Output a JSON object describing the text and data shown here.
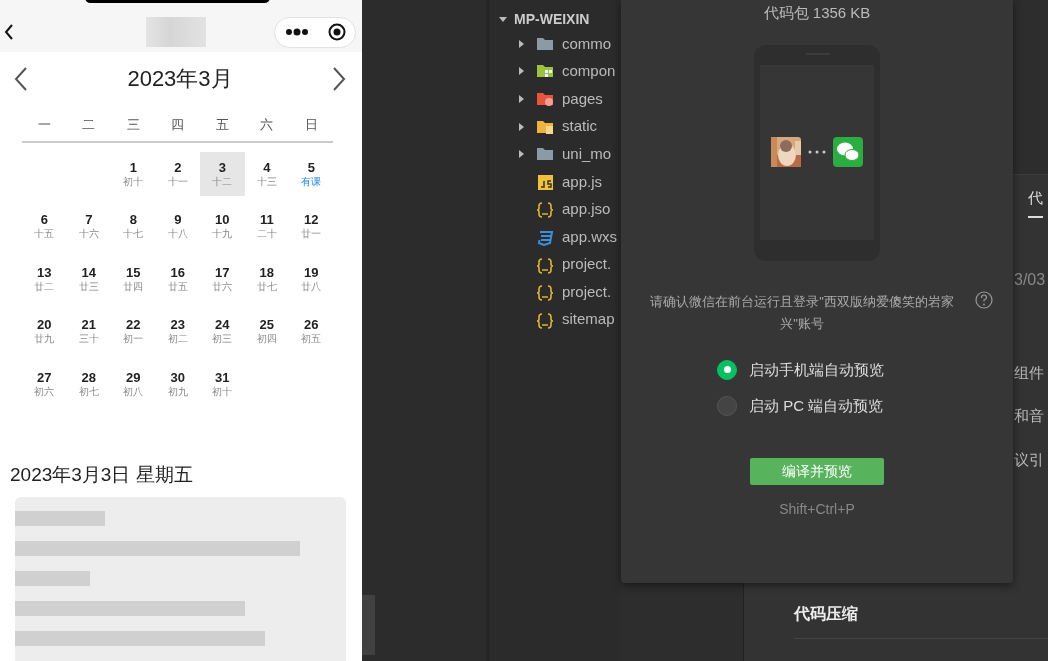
{
  "simulator": {
    "calendar": {
      "title": "2023年3月",
      "weekdays": [
        "一",
        "二",
        "三",
        "四",
        "五",
        "六",
        "日"
      ],
      "weeks": [
        [
          {
            "kind": "blank"
          },
          {
            "kind": "blank"
          },
          {
            "kind": "day",
            "day": "1",
            "lunar": "初十",
            "selected": false,
            "marked": false
          },
          {
            "kind": "day",
            "day": "2",
            "lunar": "十一",
            "selected": false,
            "marked": false
          },
          {
            "kind": "day",
            "day": "3",
            "lunar": "十二",
            "selected": true,
            "marked": false
          },
          {
            "kind": "day",
            "day": "4",
            "lunar": "十三",
            "selected": false,
            "marked": false
          },
          {
            "kind": "day",
            "day": "5",
            "lunar": "有课",
            "selected": false,
            "marked": true
          }
        ],
        [
          {
            "kind": "day",
            "day": "6",
            "lunar": "十五",
            "selected": false,
            "marked": false
          },
          {
            "kind": "day",
            "day": "7",
            "lunar": "十六",
            "selected": false,
            "marked": false
          },
          {
            "kind": "day",
            "day": "8",
            "lunar": "十七",
            "selected": false,
            "marked": false
          },
          {
            "kind": "day",
            "day": "9",
            "lunar": "十八",
            "selected": false,
            "marked": false
          },
          {
            "kind": "day",
            "day": "10",
            "lunar": "十九",
            "selected": false,
            "marked": false
          },
          {
            "kind": "day",
            "day": "11",
            "lunar": "二十",
            "selected": false,
            "marked": false
          },
          {
            "kind": "day",
            "day": "12",
            "lunar": "廿一",
            "selected": false,
            "marked": false
          }
        ],
        [
          {
            "kind": "day",
            "day": "13",
            "lunar": "廿二",
            "selected": false,
            "marked": false
          },
          {
            "kind": "day",
            "day": "14",
            "lunar": "廿三",
            "selected": false,
            "marked": false
          },
          {
            "kind": "day",
            "day": "15",
            "lunar": "廿四",
            "selected": false,
            "marked": false
          },
          {
            "kind": "day",
            "day": "16",
            "lunar": "廿五",
            "selected": false,
            "marked": false
          },
          {
            "kind": "day",
            "day": "17",
            "lunar": "廿六",
            "selected": false,
            "marked": false
          },
          {
            "kind": "day",
            "day": "18",
            "lunar": "廿七",
            "selected": false,
            "marked": false
          },
          {
            "kind": "day",
            "day": "19",
            "lunar": "廿八",
            "selected": false,
            "marked": false
          }
        ],
        [
          {
            "kind": "day",
            "day": "20",
            "lunar": "廿九",
            "selected": false,
            "marked": false
          },
          {
            "kind": "day",
            "day": "21",
            "lunar": "三十",
            "selected": false,
            "marked": false
          },
          {
            "kind": "day",
            "day": "22",
            "lunar": "初一",
            "selected": false,
            "marked": false
          },
          {
            "kind": "day",
            "day": "23",
            "lunar": "初二",
            "selected": false,
            "marked": false
          },
          {
            "kind": "day",
            "day": "24",
            "lunar": "初三",
            "selected": false,
            "marked": false
          },
          {
            "kind": "day",
            "day": "25",
            "lunar": "初四",
            "selected": false,
            "marked": false
          },
          {
            "kind": "day",
            "day": "26",
            "lunar": "初五",
            "selected": false,
            "marked": false
          }
        ],
        [
          {
            "kind": "day",
            "day": "27",
            "lunar": "初六",
            "selected": false,
            "marked": false
          },
          {
            "kind": "day",
            "day": "28",
            "lunar": "初七",
            "selected": false,
            "marked": false
          },
          {
            "kind": "day",
            "day": "29",
            "lunar": "初八",
            "selected": false,
            "marked": false
          },
          {
            "kind": "day",
            "day": "30",
            "lunar": "初九",
            "selected": false,
            "marked": false
          },
          {
            "kind": "day",
            "day": "31",
            "lunar": "初十",
            "selected": false,
            "marked": false
          },
          {
            "kind": "blank"
          },
          {
            "kind": "blank"
          }
        ]
      ]
    },
    "selected_date": "2023年3月3日 星期五"
  },
  "explorer": {
    "root": "MP-WEIXIN",
    "expanded": true,
    "items": [
      {
        "label": "commo",
        "kind": "folder",
        "expanded": false
      },
      {
        "label": "compon",
        "kind": "components",
        "expanded": false
      },
      {
        "label": "pages",
        "kind": "pages",
        "expanded": false
      },
      {
        "label": "static",
        "kind": "static",
        "expanded": false
      },
      {
        "label": "uni_mo",
        "kind": "folder",
        "expanded": false
      },
      {
        "label": "app.js",
        "kind": "script"
      },
      {
        "label": "app.jso",
        "kind": "config"
      },
      {
        "label": "app.wxs",
        "kind": "stylesheet"
      },
      {
        "label": "project.",
        "kind": "config"
      },
      {
        "label": "project.",
        "kind": "config"
      },
      {
        "label": "sitemap",
        "kind": "config"
      }
    ]
  },
  "panel": {
    "tabs": [
      {
        "label": "代",
        "selected": true
      }
    ],
    "date": "3/03",
    "lines": [
      "组件",
      "和音",
      "议引"
    ],
    "section": "代码压缩"
  },
  "dialog": {
    "size": "代码包 1356 KB",
    "message": "请确认微信在前台运行且登录\"西双版纳爱傻笑的岩家兴\"账号",
    "options": [
      {
        "label": "启动手机端自动预览",
        "selected": true
      },
      {
        "label": "启动 PC 端自动预览",
        "selected": false
      }
    ],
    "button": "编译并预览",
    "shortcut": "Shift+Ctrl+P"
  }
}
